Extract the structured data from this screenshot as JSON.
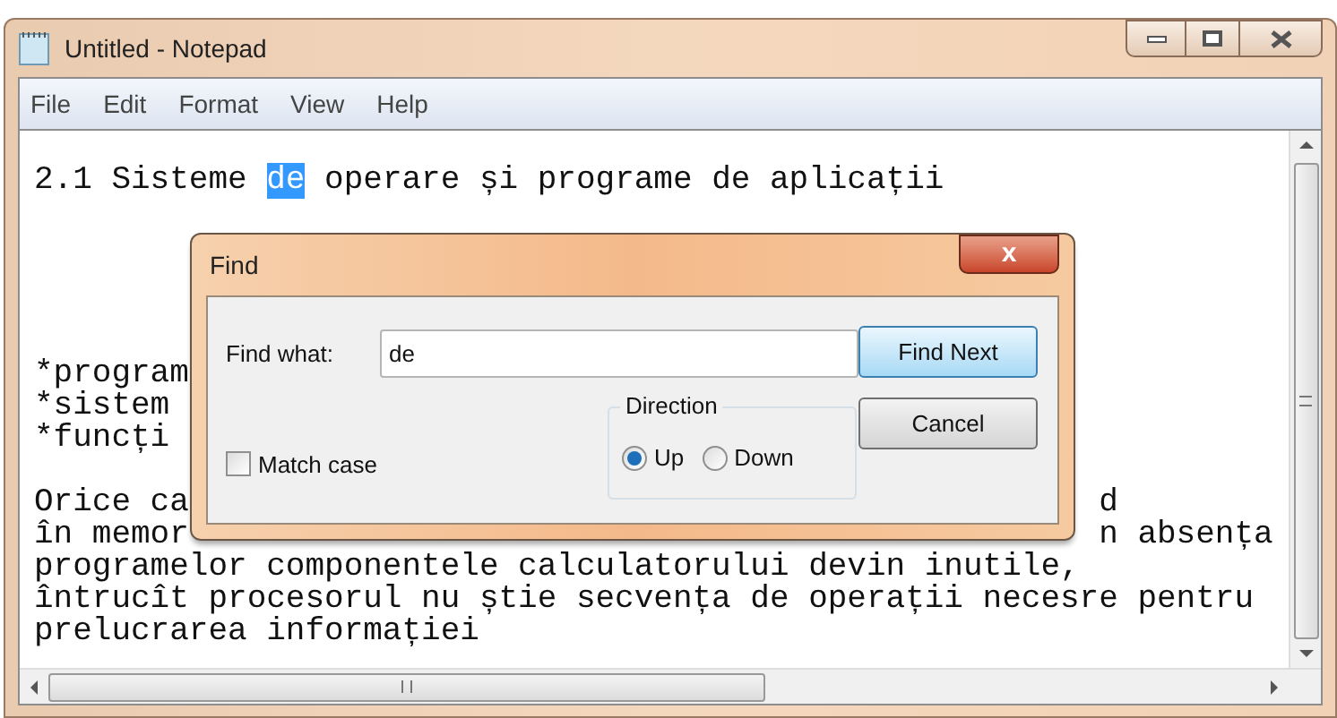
{
  "window": {
    "title": "Untitled - Notepad"
  },
  "menu": [
    "File",
    "Edit",
    "Format",
    "View",
    "Help"
  ],
  "editor": {
    "lines": [
      {
        "kind": "blank"
      },
      {
        "kind": "text",
        "segments": [
          {
            "text": "2.1 Sisteme ",
            "highlighted": false
          },
          {
            "text": "de",
            "highlighted": true
          },
          {
            "text": " operare și programe de aplicații",
            "highlighted": false
          }
        ]
      },
      {
        "kind": "blank"
      },
      {
        "kind": "blank"
      },
      {
        "kind": "blank"
      },
      {
        "kind": "blank"
      },
      {
        "kind": "blank"
      },
      {
        "kind": "text",
        "segments": [
          {
            "text": "*program",
            "highlighted": false
          }
        ]
      },
      {
        "kind": "text",
        "segments": [
          {
            "text": "*sistem",
            "highlighted": false
          }
        ]
      },
      {
        "kind": "text",
        "segments": [
          {
            "text": "*funcți",
            "highlighted": false
          }
        ]
      },
      {
        "kind": "blank"
      },
      {
        "kind": "text",
        "segments": [
          {
            "text": "Orice ca",
            "highlighted": false
          }
        ],
        "right": "d"
      },
      {
        "kind": "text",
        "segments": [
          {
            "text": "în memor",
            "highlighted": false
          }
        ],
        "right": "n absența"
      },
      {
        "kind": "text",
        "segments": [
          {
            "text": "programelor componentele calculatorului devin inutile,",
            "highlighted": false
          }
        ]
      },
      {
        "kind": "text",
        "segments": [
          {
            "text": "întrucît procesorul nu știe secvența de operații necesre pentru",
            "highlighted": false
          }
        ]
      },
      {
        "kind": "text",
        "segments": [
          {
            "text": "prelucrarea informației",
            "highlighted": false
          }
        ]
      }
    ]
  },
  "dialog": {
    "title": "Find",
    "close": "x",
    "find_what_label": "Find what:",
    "find_what_value": "de",
    "buttons": [
      {
        "label": "Find Next",
        "default": true
      },
      {
        "label": "Cancel",
        "default": false
      }
    ],
    "direction": {
      "label": "Direction",
      "options": [
        {
          "label": "Up",
          "selected": true
        },
        {
          "label": "Down",
          "selected": false
        }
      ]
    },
    "match_case": {
      "label": "Match case",
      "checked": false
    }
  }
}
